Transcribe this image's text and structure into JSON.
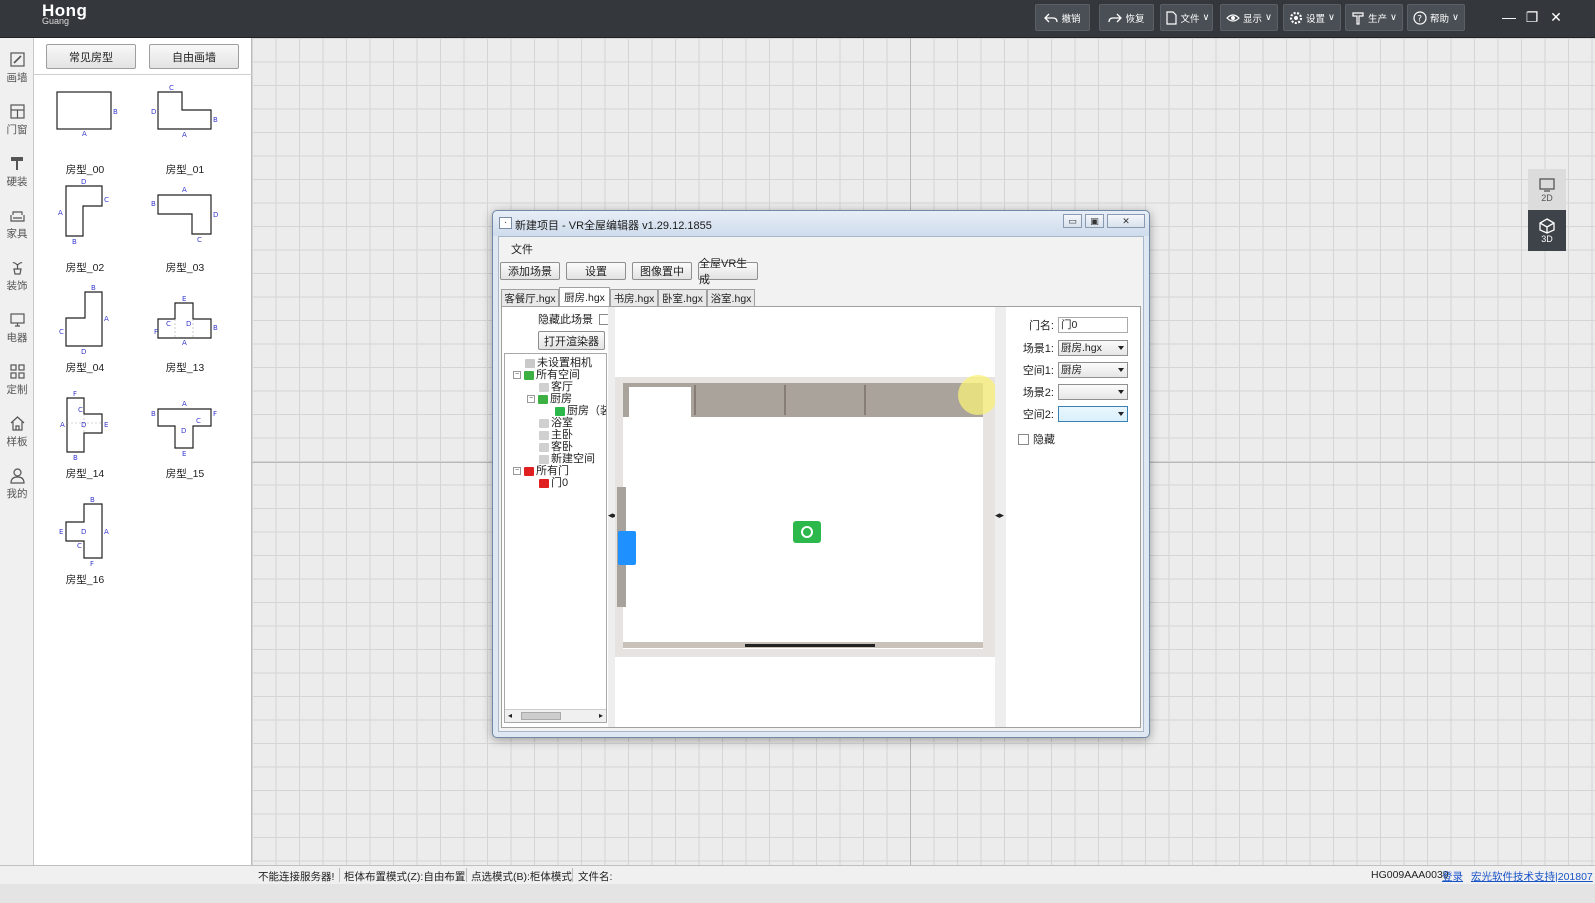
{
  "app": {
    "logo_main": "Hong",
    "logo_sub": "Guang",
    "toolbar": [
      "撤销",
      "恢复",
      "文件",
      "显示",
      "设置",
      "生产",
      "帮助"
    ]
  },
  "iconbar": [
    "画墙",
    "门窗",
    "硬装",
    "家具",
    "装饰",
    "电器",
    "定制",
    "样板",
    "我的"
  ],
  "room_panel": {
    "tab_common": "常见房型",
    "tab_free": "自由画墙",
    "rooms": [
      "房型_00",
      "房型_01",
      "房型_02",
      "房型_03",
      "房型_04",
      "房型_13",
      "房型_14",
      "房型_15",
      "房型_16"
    ]
  },
  "view_toggle": {
    "v2d": "2D",
    "v3d": "3D"
  },
  "dialog": {
    "title": "新建项目 - VR全屋编辑器 v1.29.12.1855",
    "menu_file": "文件",
    "buttons": {
      "add_scene": "添加场景",
      "settings": "设置",
      "center_image": "图像置中",
      "vr_generate": "全屋VR生成"
    },
    "tabs": [
      "客餐厅.hgx",
      "厨房.hgx",
      "书房.hgx",
      "卧室.hgx",
      "浴室.hgx"
    ],
    "active_tab": 1,
    "hide_scene": "隐藏此场景",
    "open_renderer": "打开渲染器",
    "tree": {
      "no_camera": "未设置相机",
      "all_spaces": "所有空间",
      "living": "客厅",
      "kitchen": "厨房",
      "kitchen_cam": "厨房（装",
      "bathroom": "浴室",
      "master": "主卧",
      "guest": "客卧",
      "new_space": "新建空间",
      "all_doors": "所有门",
      "door0": "门0"
    },
    "props": {
      "door_name_label": "门名:",
      "door_name_value": "门0",
      "scene1_label": "场景1:",
      "scene1_value": "厨房.hgx",
      "space1_label": "空间1:",
      "space1_value": "厨房",
      "scene2_label": "场景2:",
      "scene2_value": "",
      "space2_label": "空间2:",
      "space2_value": "",
      "hide_label": "隐藏"
    }
  },
  "status": {
    "server": "不能连接服务器!",
    "cabinet_mode": "柜体布置模式(Z):自由布置",
    "select_mode": "点选模式(B):柜体模式",
    "file_name": "文件名:",
    "machine_id": "HG009AAA0039",
    "login": "登录",
    "support": "宏光软件技术支持|201807"
  },
  "colors": {
    "topbar": "#34383d",
    "door_red": "#e02020",
    "space_green": "#3cb043",
    "camera_green": "#2db84b",
    "door_blue": "#1e90ff",
    "link": "#1a55c8"
  }
}
